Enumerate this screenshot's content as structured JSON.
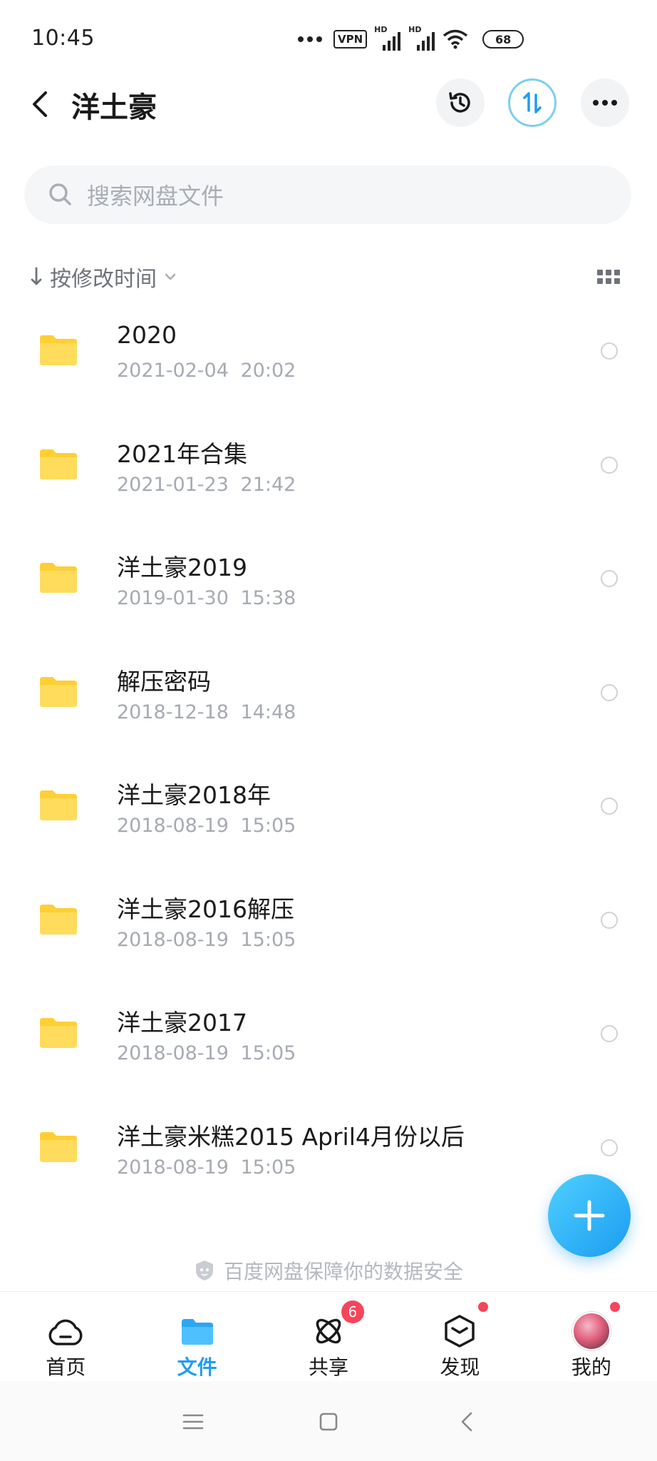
{
  "status_bar": {
    "time": "10:45",
    "vpn": "VPN",
    "hd1": "HD",
    "hd2": "HD",
    "battery": "68"
  },
  "header": {
    "title": "洋土豪"
  },
  "search": {
    "placeholder": "搜索网盘文件"
  },
  "sort": {
    "label": "按修改时间"
  },
  "files": [
    {
      "name": "2020",
      "date": "2021-02-04 20:02"
    },
    {
      "name": "2021年合集",
      "date": "2021-01-23 21:42"
    },
    {
      "name": "洋土豪2019",
      "date": "2019-01-30 15:38"
    },
    {
      "name": "解压密码",
      "date": "2018-12-18 14:48"
    },
    {
      "name": "洋土豪2018年",
      "date": "2018-08-19 15:05"
    },
    {
      "name": "洋土豪2016解压",
      "date": "2018-08-19 15:05"
    },
    {
      "name": "洋土豪2017",
      "date": "2018-08-19 15:05"
    },
    {
      "name": "洋土豪米糕2015 April4月份以后",
      "date": "2018-08-19 15:05"
    }
  ],
  "footer_note": "百度网盘保障你的数据安全",
  "tabs": [
    {
      "label": "首页",
      "icon": "cloud-icon"
    },
    {
      "label": "文件",
      "icon": "folder-icon"
    },
    {
      "label": "共享",
      "icon": "share-icon",
      "badge": "6"
    },
    {
      "label": "发现",
      "icon": "discover-icon"
    },
    {
      "label": "我的",
      "icon": "avatar"
    }
  ],
  "colors": {
    "accent": "#1f9cf2",
    "folder": "#ffd64a",
    "badge": "#f5455c"
  }
}
